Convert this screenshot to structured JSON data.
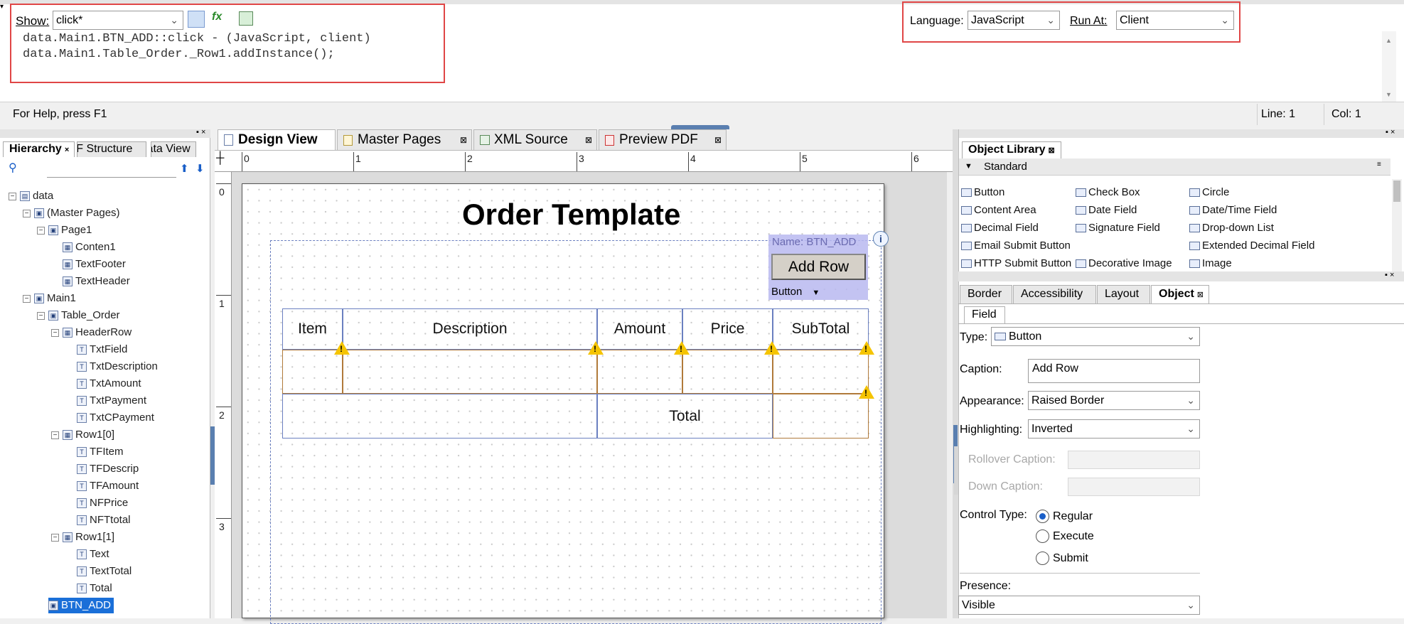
{
  "script_editor": {
    "show_label": "Show:",
    "show_value": "click*",
    "language_label": "Language:",
    "language_value": "JavaScript",
    "run_at_label": "Run At:",
    "run_at_value": "Client",
    "code_line1": "data.Main1.BTN_ADD::click - (JavaScript, client)",
    "code_line2": "data.Main1.Table_Order._Row1.addInstance();"
  },
  "status_bar": {
    "help": "For Help, press F1",
    "line": "Line: 1",
    "col": "Col: 1"
  },
  "hierarchy": {
    "tabs": [
      "Hierarchy",
      "PDF Structure",
      "Data View"
    ],
    "nodes": [
      {
        "label": "data",
        "depth": 0
      },
      {
        "label": "(Master Pages)",
        "depth": 1
      },
      {
        "label": "Page1",
        "depth": 2
      },
      {
        "label": "Conten1",
        "depth": 3
      },
      {
        "label": "TextFooter",
        "depth": 3
      },
      {
        "label": "TextHeader",
        "depth": 3
      },
      {
        "label": "Main1",
        "depth": 1
      },
      {
        "label": "Table_Order",
        "depth": 2
      },
      {
        "label": "HeaderRow",
        "depth": 3
      },
      {
        "label": "TxtField",
        "depth": 4
      },
      {
        "label": "TxtDescription",
        "depth": 4
      },
      {
        "label": "TxtAmount",
        "depth": 4
      },
      {
        "label": "TxtPayment",
        "depth": 4
      },
      {
        "label": "TxtCPayment",
        "depth": 4
      },
      {
        "label": "Row1[0]",
        "depth": 3
      },
      {
        "label": "TFItem",
        "depth": 4
      },
      {
        "label": "TFDescrip",
        "depth": 4
      },
      {
        "label": "TFAmount",
        "depth": 4
      },
      {
        "label": "NFPrice",
        "depth": 4
      },
      {
        "label": "NFTtotal",
        "depth": 4
      },
      {
        "label": "Row1[1]",
        "depth": 3
      },
      {
        "label": "Text",
        "depth": 4
      },
      {
        "label": "TextTotal",
        "depth": 4
      },
      {
        "label": "Total",
        "depth": 4
      },
      {
        "label": "BTN_ADD",
        "depth": 2
      }
    ]
  },
  "design_tabs": [
    "Design View",
    "Master Pages",
    "XML Source",
    "Preview PDF"
  ],
  "ruler": {
    "h": [
      "0",
      "1",
      "2",
      "3",
      "4",
      "5",
      "6"
    ],
    "v": [
      "0",
      "1",
      "2",
      "3"
    ]
  },
  "form": {
    "title": "Order Template",
    "button_name": "Name: BTN_ADD",
    "button_caption": "Add Row",
    "button_type": "Button",
    "headers": [
      "Item",
      "Description",
      "Amount",
      "Price",
      "SubTotal"
    ],
    "total_label": "Total"
  },
  "object_library": {
    "title": "Object Library",
    "group": "Standard",
    "items": [
      [
        "Button",
        "Check Box",
        "Circle"
      ],
      [
        "Content Area",
        "Date Field",
        "Date/Time Field"
      ],
      [
        "Decimal Field",
        "Signature Field",
        "Drop-down List"
      ],
      [
        "Email Submit Button",
        "",
        "Extended Decimal Field"
      ],
      [
        "HTTP Submit Button",
        "Decorative Image",
        "Image"
      ]
    ]
  },
  "properties": {
    "tabs": [
      "Border",
      "Accessibility",
      "Layout",
      "Object"
    ],
    "subtab": "Field",
    "type_label": "Type:",
    "type_value": "Button",
    "caption_label": "Caption:",
    "caption_value": "Add Row",
    "appearance_label": "Appearance:",
    "appearance_value": "Raised Border",
    "highlighting_label": "Highlighting:",
    "highlighting_value": "Inverted",
    "rollover_label": "Rollover Caption:",
    "down_label": "Down Caption:",
    "control_type_label": "Control Type:",
    "control_options": [
      "Regular",
      "Execute",
      "Submit"
    ],
    "control_selected": "Regular",
    "presence_label": "Presence:",
    "presence_value": "Visible"
  }
}
